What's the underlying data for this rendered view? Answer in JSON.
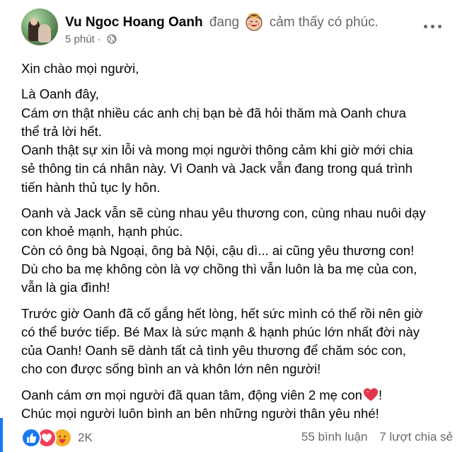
{
  "post": {
    "author": {
      "name": "Vu Ngoc Hoang Oanh",
      "avatar_icon": "profile-photo"
    },
    "feeling": {
      "prefix": "đang",
      "emoji_icon": "blessed-face-emoji",
      "text": "cảm thấy có phúc."
    },
    "meta": {
      "time": "5 phút",
      "separator": "·",
      "privacy_icon": "globe-icon"
    },
    "more_icon": "more-options-icon",
    "body": {
      "paragraphs": [
        {
          "lines": [
            "Xin chào mọi người,"
          ]
        },
        {
          "lines": [
            "Là Oanh đây,",
            "Cám ơn thật nhiều các anh chị bạn bè đã hỏi thăm mà Oanh chưa",
            "thể trả lời hết.",
            "Oanh thật sự xin lỗi và mong mọi người thông cảm khi giờ mới chia",
            "sẻ thông tin cá nhân này. Vì Oanh và Jack vẫn đang trong quá trình",
            "tiến hành thủ tục ly hôn."
          ]
        },
        {
          "lines": [
            "Oanh và Jack vẫn sẽ cùng nhau yêu thương con, cùng nhau nuôi dạy",
            "con khoẻ mạnh, hạnh phúc.",
            "Còn có ông bà Ngoại, ông bà Nội, cậu dì... ai cũng yêu thương con!",
            "Dù cho ba mẹ không còn là vợ chồng thì vẫn luôn là ba mẹ của con,",
            "vẫn là gia đình!"
          ]
        },
        {
          "lines": [
            "Trước giờ Oanh đã cố gắng hết lòng, hết sức mình có thể rồi nên giờ",
            "có thể bước tiếp. Bé Max là sức mạnh & hạnh phúc lớn nhất đời này",
            "của Oanh! Oanh sẽ dành tất cả tình yêu thương để chăm sóc con,",
            "cho con được sống bình an và khôn lớn nên người!"
          ]
        },
        {
          "lines": [
            "Oanh cám ơn mọi người đã quan tâm, động viên 2 mẹ con",
            "Chúc mọi người luôn bình an bên những người thân yêu nhé!"
          ]
        }
      ],
      "heart_suffix": "!",
      "heart_icon": "red-heart-emoji"
    },
    "footer": {
      "reactions": [
        "like-reaction-icon",
        "love-reaction-icon",
        "care-reaction-icon"
      ],
      "reaction_count": "2K",
      "comments": "55 bình luận",
      "shares": "7 lượt chia sẻ"
    }
  },
  "colors": {
    "primary_text": "#050505",
    "secondary_text": "#65676b",
    "like_blue": "#1877f2",
    "love_red": "#f33e58",
    "care_yellow": "#f7b125"
  }
}
